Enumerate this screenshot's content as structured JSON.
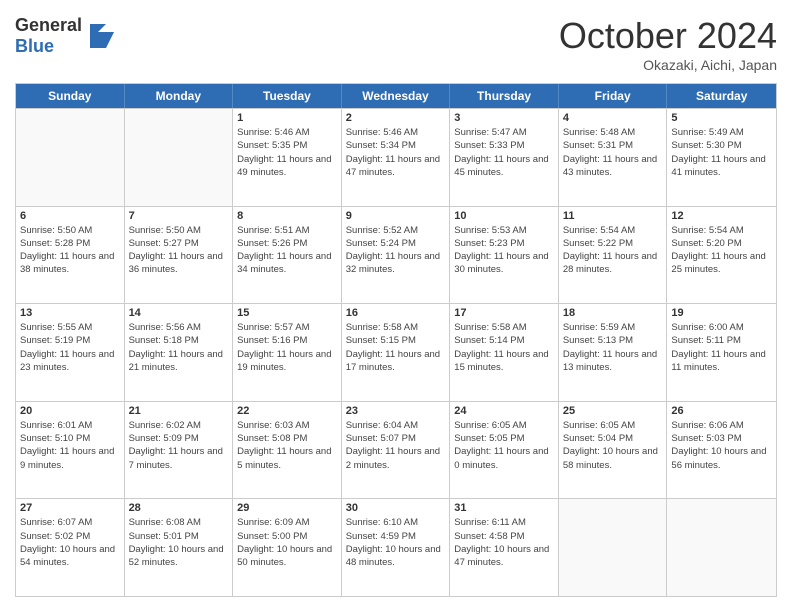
{
  "logo": {
    "general": "General",
    "blue": "Blue"
  },
  "title": "October 2024",
  "location": "Okazaki, Aichi, Japan",
  "headers": [
    "Sunday",
    "Monday",
    "Tuesday",
    "Wednesday",
    "Thursday",
    "Friday",
    "Saturday"
  ],
  "rows": [
    [
      {
        "day": "",
        "info": ""
      },
      {
        "day": "",
        "info": ""
      },
      {
        "day": "1",
        "info": "Sunrise: 5:46 AM\nSunset: 5:35 PM\nDaylight: 11 hours and 49 minutes."
      },
      {
        "day": "2",
        "info": "Sunrise: 5:46 AM\nSunset: 5:34 PM\nDaylight: 11 hours and 47 minutes."
      },
      {
        "day": "3",
        "info": "Sunrise: 5:47 AM\nSunset: 5:33 PM\nDaylight: 11 hours and 45 minutes."
      },
      {
        "day": "4",
        "info": "Sunrise: 5:48 AM\nSunset: 5:31 PM\nDaylight: 11 hours and 43 minutes."
      },
      {
        "day": "5",
        "info": "Sunrise: 5:49 AM\nSunset: 5:30 PM\nDaylight: 11 hours and 41 minutes."
      }
    ],
    [
      {
        "day": "6",
        "info": "Sunrise: 5:50 AM\nSunset: 5:28 PM\nDaylight: 11 hours and 38 minutes."
      },
      {
        "day": "7",
        "info": "Sunrise: 5:50 AM\nSunset: 5:27 PM\nDaylight: 11 hours and 36 minutes."
      },
      {
        "day": "8",
        "info": "Sunrise: 5:51 AM\nSunset: 5:26 PM\nDaylight: 11 hours and 34 minutes."
      },
      {
        "day": "9",
        "info": "Sunrise: 5:52 AM\nSunset: 5:24 PM\nDaylight: 11 hours and 32 minutes."
      },
      {
        "day": "10",
        "info": "Sunrise: 5:53 AM\nSunset: 5:23 PM\nDaylight: 11 hours and 30 minutes."
      },
      {
        "day": "11",
        "info": "Sunrise: 5:54 AM\nSunset: 5:22 PM\nDaylight: 11 hours and 28 minutes."
      },
      {
        "day": "12",
        "info": "Sunrise: 5:54 AM\nSunset: 5:20 PM\nDaylight: 11 hours and 25 minutes."
      }
    ],
    [
      {
        "day": "13",
        "info": "Sunrise: 5:55 AM\nSunset: 5:19 PM\nDaylight: 11 hours and 23 minutes."
      },
      {
        "day": "14",
        "info": "Sunrise: 5:56 AM\nSunset: 5:18 PM\nDaylight: 11 hours and 21 minutes."
      },
      {
        "day": "15",
        "info": "Sunrise: 5:57 AM\nSunset: 5:16 PM\nDaylight: 11 hours and 19 minutes."
      },
      {
        "day": "16",
        "info": "Sunrise: 5:58 AM\nSunset: 5:15 PM\nDaylight: 11 hours and 17 minutes."
      },
      {
        "day": "17",
        "info": "Sunrise: 5:58 AM\nSunset: 5:14 PM\nDaylight: 11 hours and 15 minutes."
      },
      {
        "day": "18",
        "info": "Sunrise: 5:59 AM\nSunset: 5:13 PM\nDaylight: 11 hours and 13 minutes."
      },
      {
        "day": "19",
        "info": "Sunrise: 6:00 AM\nSunset: 5:11 PM\nDaylight: 11 hours and 11 minutes."
      }
    ],
    [
      {
        "day": "20",
        "info": "Sunrise: 6:01 AM\nSunset: 5:10 PM\nDaylight: 11 hours and 9 minutes."
      },
      {
        "day": "21",
        "info": "Sunrise: 6:02 AM\nSunset: 5:09 PM\nDaylight: 11 hours and 7 minutes."
      },
      {
        "day": "22",
        "info": "Sunrise: 6:03 AM\nSunset: 5:08 PM\nDaylight: 11 hours and 5 minutes."
      },
      {
        "day": "23",
        "info": "Sunrise: 6:04 AM\nSunset: 5:07 PM\nDaylight: 11 hours and 2 minutes."
      },
      {
        "day": "24",
        "info": "Sunrise: 6:05 AM\nSunset: 5:05 PM\nDaylight: 11 hours and 0 minutes."
      },
      {
        "day": "25",
        "info": "Sunrise: 6:05 AM\nSunset: 5:04 PM\nDaylight: 10 hours and 58 minutes."
      },
      {
        "day": "26",
        "info": "Sunrise: 6:06 AM\nSunset: 5:03 PM\nDaylight: 10 hours and 56 minutes."
      }
    ],
    [
      {
        "day": "27",
        "info": "Sunrise: 6:07 AM\nSunset: 5:02 PM\nDaylight: 10 hours and 54 minutes."
      },
      {
        "day": "28",
        "info": "Sunrise: 6:08 AM\nSunset: 5:01 PM\nDaylight: 10 hours and 52 minutes."
      },
      {
        "day": "29",
        "info": "Sunrise: 6:09 AM\nSunset: 5:00 PM\nDaylight: 10 hours and 50 minutes."
      },
      {
        "day": "30",
        "info": "Sunrise: 6:10 AM\nSunset: 4:59 PM\nDaylight: 10 hours and 48 minutes."
      },
      {
        "day": "31",
        "info": "Sunrise: 6:11 AM\nSunset: 4:58 PM\nDaylight: 10 hours and 47 minutes."
      },
      {
        "day": "",
        "info": ""
      },
      {
        "day": "",
        "info": ""
      }
    ]
  ]
}
